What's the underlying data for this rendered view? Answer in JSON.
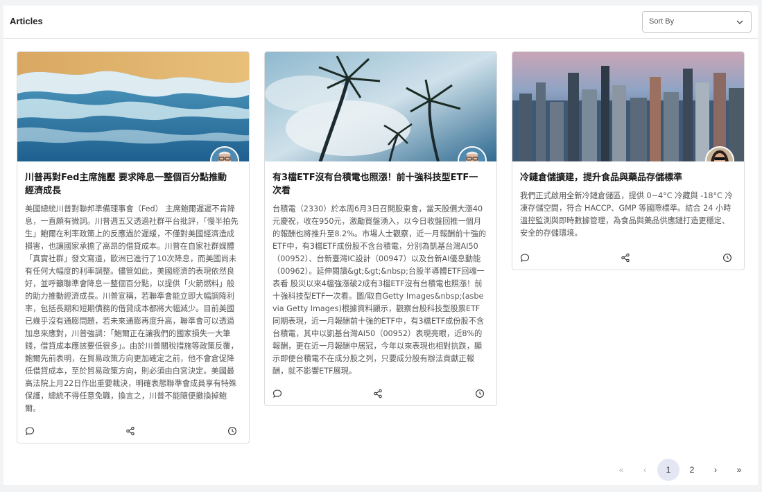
{
  "header": {
    "title": "Articles",
    "sort_label": "Sort By"
  },
  "articles": [
    {
      "title": "川普再對Fed主席施壓 要求降息一整個百分點推動經濟成長",
      "body": "美國總統川普對聯邦準備理事會（Fed） 主席鮑爾遲遲不肯降息，一直頗有微詞。川普週五又透過社群平台批評，「慢半拍先生」鮑爾在利率政策上的反應過於遲緩，不僅對美國經濟造成損害，也讓國家承擔了高昂的借貸成本。川普在自家社群媒體「真實社群」發文寫道，歐洲已進行了10次降息，而美國尚未有任何大幅度的利率調整。儘管如此，美國經濟的表現依然良好，並呼籲聯準會降息一整個百分點，以提供「火箭燃料」般的助力推動經濟成長。川普宣稱，若聯準會能立即大幅調降利率，包括長期和短期債務的借貸成本都將大幅減少。目前美國已幾乎沒有通膨問題，若未來通膨再度升高，聯準會可以透過加息來應對，川普強調：「鮑爾正在讓我們的國家損失一大筆錢，借貸成本應該要低很多」。由於川普關稅措施等政策反覆，鮑爾先前表明，在貿易政策方向更加確定之前，他不會倉促降低借貸成本，至於貿易政策方向，則必須由白宮決定。美國最高法院上月22日作出重要裁決，明確表態聯準會成員享有特殊保護，總統不得任意免職，換言之，川普不能隨便撤換掉鮑爾。",
      "image": "ocean-waves-aerial",
      "avatar": "man-glasses-avatar"
    },
    {
      "title": "有3檔ETF沒有台積電也照漲！前十強科技型ETF一次看",
      "body": "台積電（2330）於本周6月3日召開股東會，當天股價大漲40元慶祝，收在950元，激勵買盤湧入，以今日收盤回推一個月的報酬也將推升至8.2%。市場人士觀察，近一月報酬前十強的ETF中，有3檔ETF成份股不含台積電，分別為凱基台灣AI50（00952）、台新臺灣IC設計（00947）以及台新AI優息動能（00962）。延伸閱讀&gt;&gt;&nbsp;台股半導體ETF回魂一表看 股災以來4檔強漲破2成有3檔ETF沒有台積電也照漲！前十強科技型ETF一次看。圖/取自Getty Images&nbsp;(asbe via Getty Images)根據資料顯示，觀察台股科技型股票ETF同期表現，近一月報酬前十強的ETF中，有3檔ETF成份股不含台積電，其中以凱基台灣AI50（00952）表現亮眼，近8%的報酬，更在近一月報酬中居冠，今年以來表現也相對抗跌，顯示即便台積電不在成分股之列，只要成分股有辦法貢獻正報酬，就不影響ETF展現。",
      "image": "palm-trees-sky",
      "avatar": "man-glasses-avatar"
    },
    {
      "title": "冷鏈倉儲擴建，提升食品與藥品存儲標準",
      "body": "我們正式啟用全新冷鏈倉儲區，提供 0~4°C 冷藏與 -18°C 冷凍存儲空間，符合 HACCP、GMP 等國際標準。結合 24 小時溫控監測與即時數據管理，為食品與藥品供應鏈打造更穩定、安全的存儲環境。",
      "image": "city-skyline",
      "avatar": "woman-sunglasses-avatar"
    }
  ],
  "icons": {
    "comment": "comment-icon",
    "share": "share-icon",
    "clock": "clock-icon"
  },
  "pagination": {
    "first": "«",
    "prev": "‹",
    "pages": [
      "1",
      "2"
    ],
    "active": "1",
    "next": "›",
    "last": "»"
  }
}
